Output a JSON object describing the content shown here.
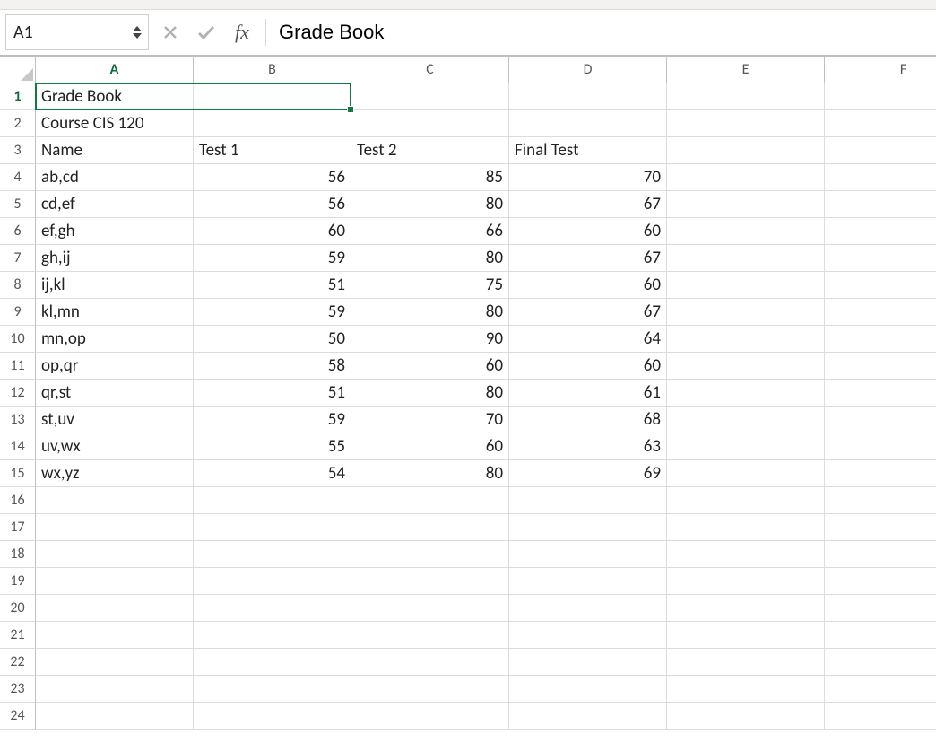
{
  "nameBox": {
    "value": "A1"
  },
  "formulaBar": {
    "cancel_label": "",
    "confirm_label": "",
    "fx_label": "fx",
    "value": "Grade Book"
  },
  "columns": [
    {
      "label": "A",
      "width": 176
    },
    {
      "label": "B",
      "width": 176
    },
    {
      "label": "C",
      "width": 176
    },
    {
      "label": "D",
      "width": 176
    },
    {
      "label": "E",
      "width": 176
    },
    {
      "label": "F",
      "width": 176
    }
  ],
  "totalRows": 24,
  "activeCell": {
    "col": 0,
    "row": 0,
    "colspan": 2,
    "rowspan": 1
  },
  "rowsData": [
    {
      "cells": [
        "Grade Book",
        null,
        null,
        null,
        null,
        null
      ]
    },
    {
      "cells": [
        "Course CIS 120",
        null,
        null,
        null,
        null,
        null
      ]
    },
    {
      "cells": [
        "Name",
        "Test 1",
        "Test 2",
        "Final Test",
        null,
        null
      ],
      "textCols": [
        0,
        1,
        2,
        3
      ]
    },
    {
      "cells": [
        "ab,cd",
        56,
        85,
        70,
        null,
        null
      ]
    },
    {
      "cells": [
        "cd,ef",
        56,
        80,
        67,
        null,
        null
      ]
    },
    {
      "cells": [
        "ef,gh",
        60,
        66,
        60,
        null,
        null
      ]
    },
    {
      "cells": [
        "gh,ij",
        59,
        80,
        67,
        null,
        null
      ]
    },
    {
      "cells": [
        "ij,kl",
        51,
        75,
        60,
        null,
        null
      ]
    },
    {
      "cells": [
        "kl,mn",
        59,
        80,
        67,
        null,
        null
      ]
    },
    {
      "cells": [
        "mn,op",
        50,
        90,
        64,
        null,
        null
      ]
    },
    {
      "cells": [
        "op,qr",
        58,
        60,
        60,
        null,
        null
      ]
    },
    {
      "cells": [
        "qr,st",
        51,
        80,
        61,
        null,
        null
      ]
    },
    {
      "cells": [
        "st,uv",
        59,
        70,
        68,
        null,
        null
      ]
    },
    {
      "cells": [
        "uv,wx",
        55,
        60,
        63,
        null,
        null
      ]
    },
    {
      "cells": [
        "wx,yz",
        54,
        80,
        69,
        null,
        null
      ]
    }
  ]
}
